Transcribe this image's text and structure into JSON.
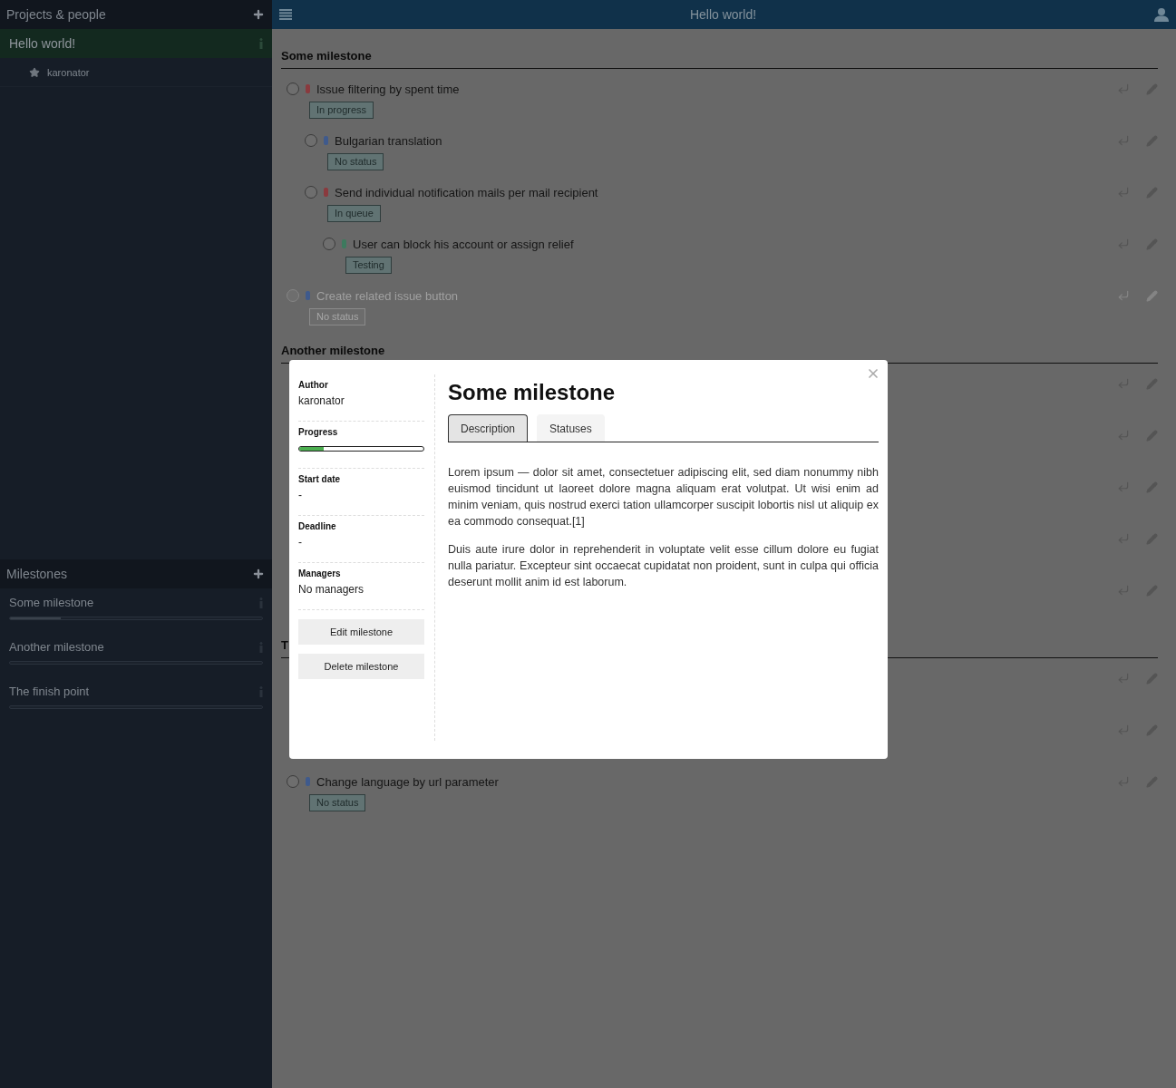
{
  "sidebar": {
    "projects_header": {
      "title": "Projects & people"
    },
    "projects": [
      {
        "name": "Hello world!",
        "selected": true,
        "members": [
          {
            "name": "karonator"
          }
        ]
      }
    ],
    "milestones_header": {
      "title": "Milestones"
    },
    "milestones": [
      {
        "name": "Some milestone",
        "level": 0.2
      },
      {
        "name": "Another milestone",
        "level": 0
      },
      {
        "name": "The finish point",
        "level": 0
      }
    ]
  },
  "topbar": {
    "title": "Hello world!"
  },
  "milestones": [
    {
      "title": "Some milestone",
      "issues": [
        {
          "title": "Issue filtering by spent time",
          "color": "#8a3a3e",
          "status": "In progress",
          "disabled": false,
          "children": [
            {
              "title": "Bulgarian translation",
              "color": "#3f5a8c",
              "status": "No status",
              "disabled": false
            },
            {
              "title": "Send individual notification mails per mail recipient",
              "color": "#8a3a3e",
              "status": "In queue",
              "disabled": false,
              "children": [
                {
                  "title": "User can block his account or assign relief",
                  "color": "#3d7a5e",
                  "status": "Testing",
                  "disabled": false
                }
              ]
            }
          ]
        },
        {
          "title": "Create related issue button",
          "color": "#3f5a8c",
          "status": "No status",
          "disabled": true
        }
      ]
    },
    {
      "title": "Another milestone",
      "issues": [
        {
          "disabled": false
        },
        {
          "disabled": false
        },
        {
          "disabled": false
        },
        {
          "disabled": false
        },
        {
          "disabled": false
        }
      ]
    },
    {
      "title": "T",
      "issues": [
        {
          "disabled": false
        },
        {
          "disabled": false
        },
        {
          "title": "Change language by url parameter",
          "color": "#3f5a8c",
          "status": "No status",
          "disabled": false
        }
      ]
    }
  ],
  "modal": {
    "fields": [
      {
        "kind": "text",
        "label": "Author",
        "value": "karonator"
      },
      {
        "kind": "progress",
        "label": "Progress",
        "level": 0.2
      },
      {
        "kind": "text",
        "label": "Start date",
        "value": "-"
      },
      {
        "kind": "text",
        "label": "Deadline",
        "value": "-"
      },
      {
        "kind": "text",
        "label": "Managers",
        "value": "No managers"
      }
    ],
    "buttons": [
      "Edit milestone",
      "Delete milestone"
    ],
    "title": "Some milestone",
    "tabs": [
      {
        "label": "Description",
        "selected": true
      },
      {
        "label": "Statuses",
        "selected": false
      }
    ],
    "paragraphs": [
      "Lorem ipsum — dolor sit amet, consectetuer adipiscing elit, sed diam nonummy nibh euismod tincidunt ut laoreet dolore magna aliquam erat volutpat. Ut wisi enim ad minim veniam, quis nostrud exerci tation ullamcorper suscipit lobortis nisl ut aliquip ex ea commodo consequat.[1]",
      "Duis aute irure dolor in reprehenderit in voluptate velit esse cillum dolore eu fugiat nulla pariatur. Excepteur sint occaecat cupidatat non proident, sunt in culpa qui officia deserunt mollit anim id est laborum."
    ]
  }
}
